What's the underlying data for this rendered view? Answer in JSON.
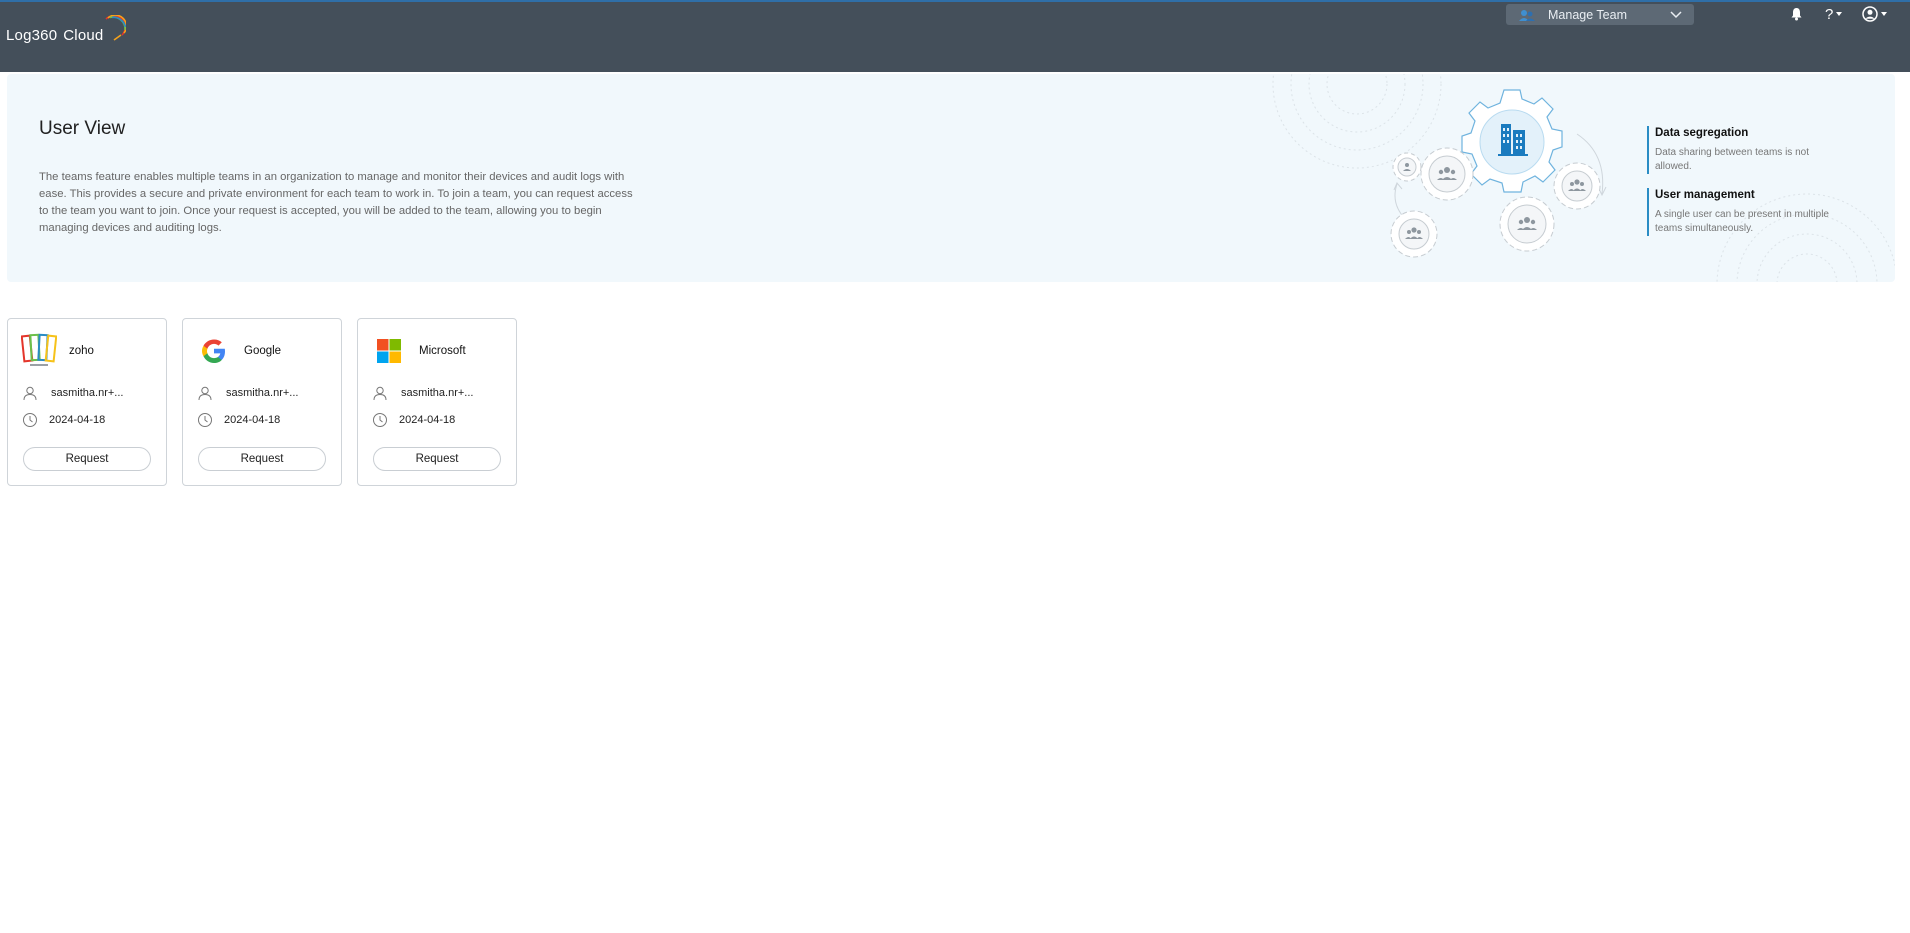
{
  "app": {
    "logo_main": "Log360",
    "logo_sub": "Cloud"
  },
  "header": {
    "team_selector": {
      "label": "Manage Team",
      "icon": "team-icon"
    },
    "icons": [
      "bell-icon",
      "help-icon",
      "user-account-icon"
    ],
    "help_label": "?"
  },
  "banner": {
    "title": "User View",
    "description": "The teams feature enables multiple teams in an organization to manage and monitor their devices and audit logs with ease. This provides a secure and private environment for each team to work in. To join a team, you can request access to the team you want to join. Once your request is accepted, you will be added to the team, allowing you to begin managing devices and auditing logs.",
    "features": [
      {
        "title": "Data segregation",
        "desc": "Data sharing between teams is not allowed."
      },
      {
        "title": "User management",
        "desc": "A single user can be present in multiple teams simultaneously."
      }
    ]
  },
  "teams": [
    {
      "name": "zoho",
      "owner": "sasmitha.nr+...",
      "date": "2024-04-18",
      "button": "Request",
      "logo": "zoho-logo"
    },
    {
      "name": "Google",
      "owner": "sasmitha.nr+...",
      "date": "2024-04-18",
      "button": "Request",
      "logo": "google-logo"
    },
    {
      "name": "Microsoft",
      "owner": "sasmitha.nr+...",
      "date": "2024-04-18",
      "button": "Request",
      "logo": "microsoft-logo"
    }
  ],
  "colors": {
    "topbar": "#444f5a",
    "banner_bg": "#f1f8fc",
    "accent": "#2a8cc4",
    "selector_bg": "#5d6975"
  }
}
